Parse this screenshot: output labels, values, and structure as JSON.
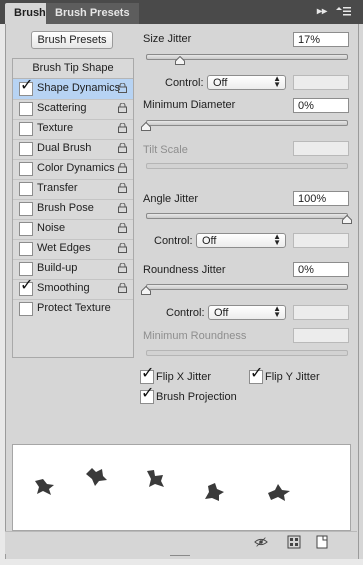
{
  "tabs": [
    {
      "label": "Brush"
    },
    {
      "label": "Brush Presets"
    }
  ],
  "brush_presets_button": "Brush Presets",
  "list": {
    "header": "Brush Tip Shape",
    "items": [
      {
        "label": "Shape Dynamics",
        "checked": true,
        "selected": true
      },
      {
        "label": "Scattering",
        "checked": false
      },
      {
        "label": "Texture",
        "checked": false
      },
      {
        "label": "Dual Brush",
        "checked": false
      },
      {
        "label": "Color Dynamics",
        "checked": false
      },
      {
        "label": "Transfer",
        "checked": false
      },
      {
        "label": "Brush Pose",
        "checked": false
      },
      {
        "label": "Noise",
        "checked": false
      },
      {
        "label": "Wet Edges",
        "checked": false
      },
      {
        "label": "Build-up",
        "checked": false
      },
      {
        "label": "Smoothing",
        "checked": true
      },
      {
        "label": "Protect Texture",
        "checked": false
      }
    ]
  },
  "settings": {
    "size_jitter": {
      "label": "Size Jitter",
      "value": "17%",
      "level": 0.17
    },
    "control_1": {
      "label": "Control:",
      "value": "Off"
    },
    "minimum_diameter": {
      "label": "Minimum Diameter",
      "value": "0%",
      "level": 0.0
    },
    "tilt_scale": {
      "label": "Tilt Scale"
    },
    "angle_jitter": {
      "label": "Angle Jitter",
      "value": "100%",
      "level": 1.0
    },
    "control_2": {
      "label": "Control:",
      "value": "Off"
    },
    "roundness_jitter": {
      "label": "Roundness Jitter",
      "value": "0%",
      "level": 0.0
    },
    "control_3": {
      "label": "Control:",
      "value": "Off"
    },
    "minimum_roundness": {
      "label": "Minimum Roundness"
    },
    "checkboxes": [
      {
        "label": "Flip X Jitter",
        "checked": true
      },
      {
        "label": "Flip Y Jitter",
        "checked": true
      },
      {
        "label": "Brush Projection",
        "checked": true
      }
    ]
  },
  "bottom_icons": [
    "eye-cycle-icon",
    "grid-icon",
    "new-preset-icon"
  ],
  "colors": {
    "panel": "#d6d6d6",
    "tabbar": "#4a4a4a",
    "selection": "#b7d3f3"
  }
}
